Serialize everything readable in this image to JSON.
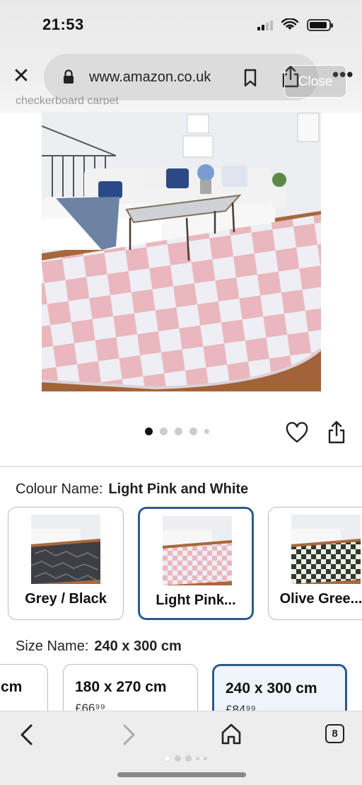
{
  "status": {
    "time": "21:53"
  },
  "browser": {
    "url": "www.amazon.co.uk",
    "close_overlay": "Close",
    "cut_title": "checkerboard carpet"
  },
  "product": {
    "image_alt": "Pink and white checkered fluffy rug in living room",
    "carousel_count": 5,
    "carousel_active": 0
  },
  "colour": {
    "label": "Colour Name:",
    "value": "Light Pink and White",
    "options": [
      {
        "label": "Grey / Black"
      },
      {
        "label": "Light Pink..."
      },
      {
        "label": "Olive Gree..."
      }
    ]
  },
  "size": {
    "label": "Size Name:",
    "value": "240 x 300 cm",
    "options": [
      {
        "size": "cm",
        "price": ""
      },
      {
        "size": "180 x 270 cm",
        "price": "£66⁹⁹"
      },
      {
        "size": "240 x 300 cm",
        "price": "£84⁹⁹"
      }
    ]
  },
  "toolbar": {
    "tabs_count": "8"
  },
  "colors": {
    "selected_border": "#2e5b8c",
    "rug_pink": "#e9b7bd",
    "rug_white": "#eeeef4"
  }
}
